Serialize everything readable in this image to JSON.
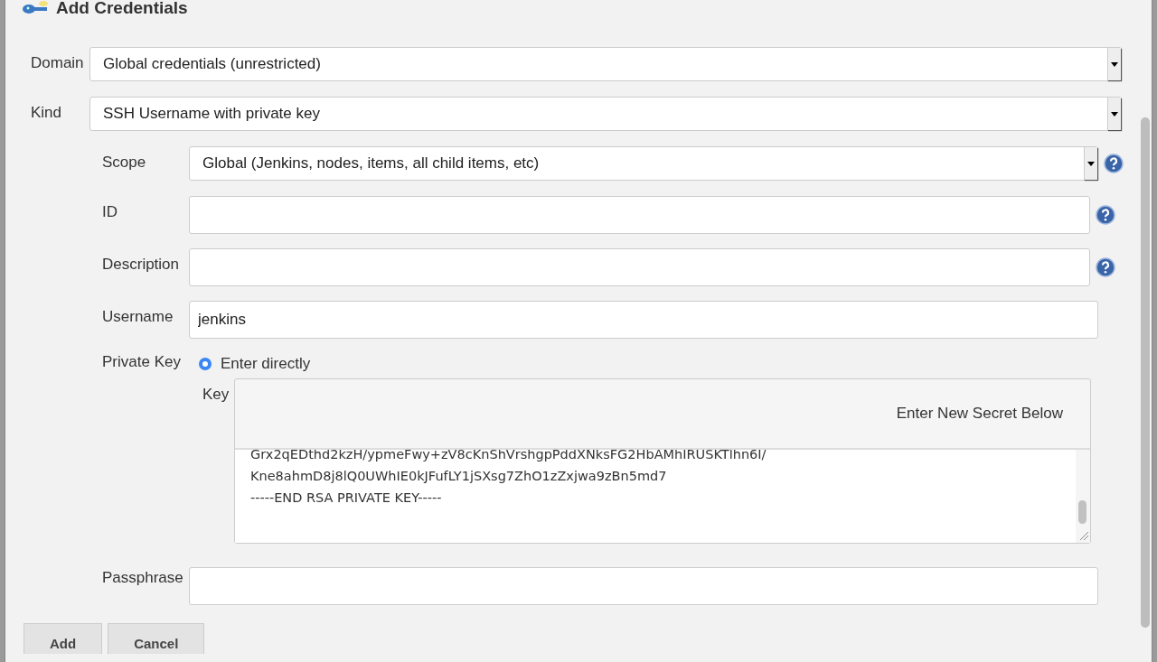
{
  "dialog": {
    "title": "Add Credentials"
  },
  "top_fields": [
    {
      "label": "Domain",
      "value": "Global credentials (unrestricted)"
    },
    {
      "label": "Kind",
      "value": "SSH Username with private key"
    }
  ],
  "fields": [
    {
      "kind": "select",
      "label": "Scope",
      "value": "Global (Jenkins, nodes, items, all child items, etc)",
      "help": true
    },
    {
      "kind": "text",
      "label": "ID",
      "help": true
    },
    {
      "kind": "text",
      "label": "Description",
      "help": true
    },
    {
      "kind": "text",
      "label": "Username",
      "value": "jenkins",
      "help": false
    }
  ],
  "private_key": {
    "label": "Private Key",
    "option": {
      "label": "Enter directly",
      "selected": true
    },
    "key_label": "Key",
    "banner": "Enter New Secret Below",
    "lines": [
      "Grx2qEDthd2kzH/ypmeFwy+zV8cKnShVrshgpPddXNksFG2HbAMhIRUSKTlhn6I/",
      "Kne8ahmD8j8lQ0UWhIE0kJFufLY1jSXsg7ZhO1zZxjwa9zBn5md7",
      "-----END RSA PRIVATE KEY-----"
    ]
  },
  "passphrase": {
    "label": "Passphrase"
  },
  "buttons": [
    "Add",
    "Cancel"
  ]
}
